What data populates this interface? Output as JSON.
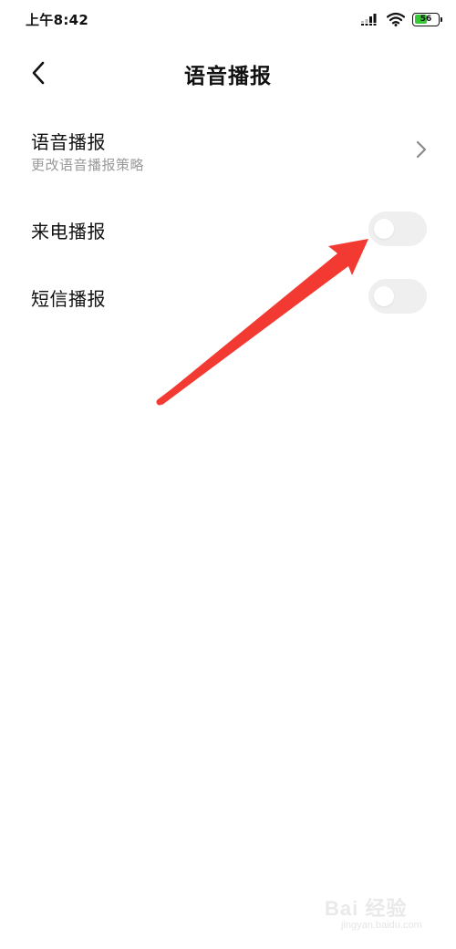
{
  "status_bar": {
    "time": "上午8:42",
    "battery_level": "56",
    "battery_fraction": 0.56,
    "battery_color": "#37c837",
    "icons": [
      "signal-icon",
      "wifi-icon",
      "battery-icon"
    ]
  },
  "header": {
    "back_icon": "chevron-left-icon",
    "title": "语音播报"
  },
  "settings": {
    "voice": {
      "title": "语音播报",
      "subtitle": "更改语音播报策略",
      "icon": "chevron-right-icon"
    },
    "call_announce": {
      "title": "来电播报",
      "enabled": false
    },
    "sms_announce": {
      "title": "短信播报",
      "enabled": false
    }
  },
  "annotation": {
    "type": "red-arrow",
    "color": "#f23a32"
  },
  "watermark": {
    "main": "Bai 经验",
    "sub": "jingyan.baidu.com"
  }
}
